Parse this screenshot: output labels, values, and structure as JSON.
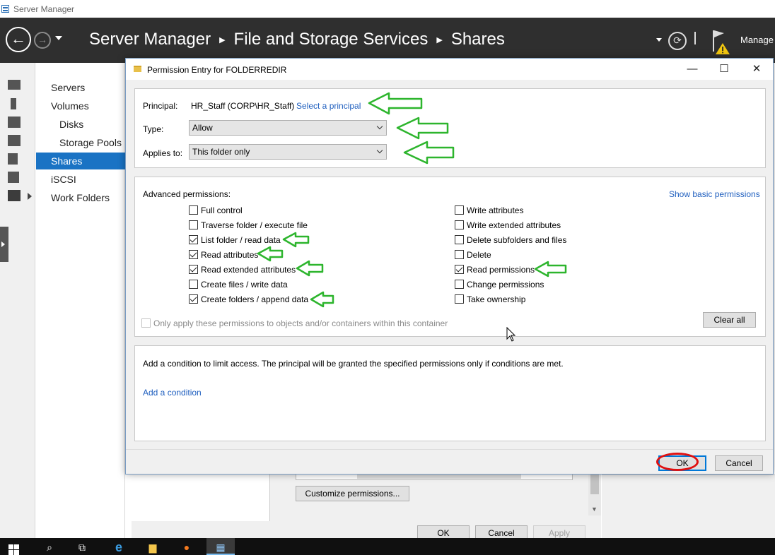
{
  "window": {
    "title": "Server Manager"
  },
  "header": {
    "breadcrumb": [
      "Server Manager",
      "File and Storage Services",
      "Shares"
    ],
    "manage_label": "Manage"
  },
  "iconbar": {
    "icons": [
      "dashboard-icon",
      "local-server-icon",
      "all-servers-icon",
      "file-storage-icon",
      "tools-icon",
      "users-icon",
      "file-services-icon"
    ]
  },
  "subnav": {
    "items": [
      {
        "label": "Servers"
      },
      {
        "label": "Volumes"
      },
      {
        "label": "Disks"
      },
      {
        "label": "Storage Pools"
      },
      {
        "label": "Shares",
        "selected": true
      },
      {
        "label": "iSCSI"
      },
      {
        "label": "Work Folders"
      }
    ]
  },
  "background_sheet": {
    "customize_label": "Customize permissions...",
    "ok_label": "OK",
    "cancel_label": "Cancel",
    "apply_label": "Apply"
  },
  "dialog": {
    "title": "Permission Entry for FOLDERREDIR",
    "principal_label": "Principal:",
    "principal_value": "HR_Staff (CORP\\HR_Staff)",
    "select_principal_link": "Select a principal",
    "type_label": "Type:",
    "type_value": "Allow",
    "applies_label": "Applies to:",
    "applies_value": "This folder only",
    "advanced_label": "Advanced permissions:",
    "show_basic_link": "Show basic permissions",
    "permissions_left": [
      {
        "label": "Full control",
        "checked": false
      },
      {
        "label": "Traverse folder / execute file",
        "checked": false
      },
      {
        "label": "List folder / read data",
        "checked": true
      },
      {
        "label": "Read attributes",
        "checked": true
      },
      {
        "label": "Read extended attributes",
        "checked": true
      },
      {
        "label": "Create files / write data",
        "checked": false
      },
      {
        "label": "Create folders / append data",
        "checked": true
      }
    ],
    "permissions_right": [
      {
        "label": "Write attributes",
        "checked": false
      },
      {
        "label": "Write extended attributes",
        "checked": false
      },
      {
        "label": "Delete subfolders and files",
        "checked": false
      },
      {
        "label": "Delete",
        "checked": false
      },
      {
        "label": "Read permissions",
        "checked": true
      },
      {
        "label": "Change permissions",
        "checked": false
      },
      {
        "label": "Take ownership",
        "checked": false
      }
    ],
    "only_apply_label": "Only apply these permissions to objects and/or containers within this container",
    "clear_all_label": "Clear all",
    "condition_text": "Add a condition to limit access. The principal will be granted the specified permissions only if conditions are met.",
    "add_condition_link": "Add a condition",
    "ok_label": "OK",
    "cancel_label": "Cancel"
  },
  "annotation_colors": {
    "arrow": "#2db52d",
    "ring": "#e01010"
  }
}
